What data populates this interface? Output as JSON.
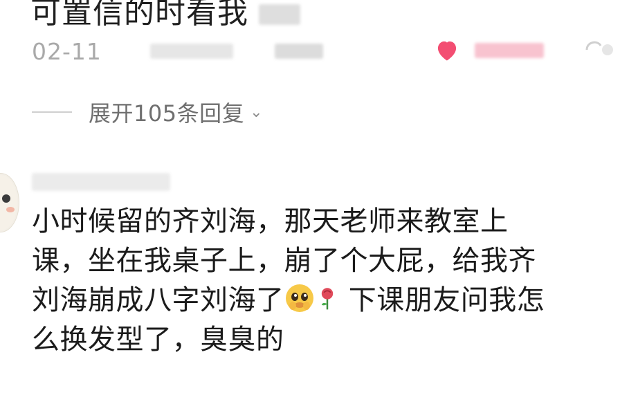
{
  "top_comment": {
    "text_partial": "可置信的时看我"
  },
  "meta": {
    "date": "02-11"
  },
  "replies": {
    "expand_label": "展开105条回复",
    "chevron": "⌄"
  },
  "comment": {
    "lines": [
      "小时候留的齐刘海，那天老师来教室上",
      "课，坐在我桌子上，崩了个大屁，给我齐",
      "刘海崩成八字刘海了",
      "下课朋友问我怎",
      "么换发型了，臭臭的"
    ]
  },
  "icons": {
    "like": "heart-icon",
    "reply": "reply-icon",
    "expand": "chevron-down-icon",
    "emoji_1": "pleading-face-emoji",
    "emoji_2": "rose-emoji"
  },
  "colors": {
    "like_red": "#f2305a",
    "meta_gray": "#a9a9a9",
    "text_dark": "#1b1b1b"
  }
}
